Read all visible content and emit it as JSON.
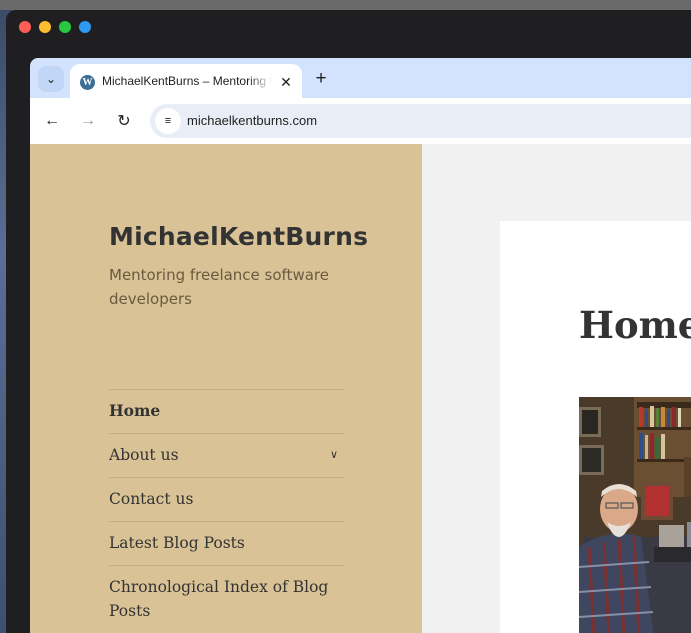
{
  "browser": {
    "tab": {
      "title": "MichaelKentBurns – Mentoring freelance software developers"
    },
    "address": {
      "url": "michaelkentburns.com"
    }
  },
  "site": {
    "title": "MichaelKentBurns",
    "tagline": "Mentoring freelance software developers",
    "menu": [
      {
        "label": "Home",
        "active": true
      },
      {
        "label": "About us",
        "has_submenu": true
      },
      {
        "label": "Contact us"
      },
      {
        "label": "Latest Blog Posts"
      },
      {
        "label": "Chronological Index of Blog Posts"
      }
    ]
  },
  "main": {
    "page_title": "Home"
  },
  "colors": {
    "sidebar": "#d9c295",
    "page_bg": "#f1f1f1",
    "tabstrip": "#d3e3fd"
  }
}
